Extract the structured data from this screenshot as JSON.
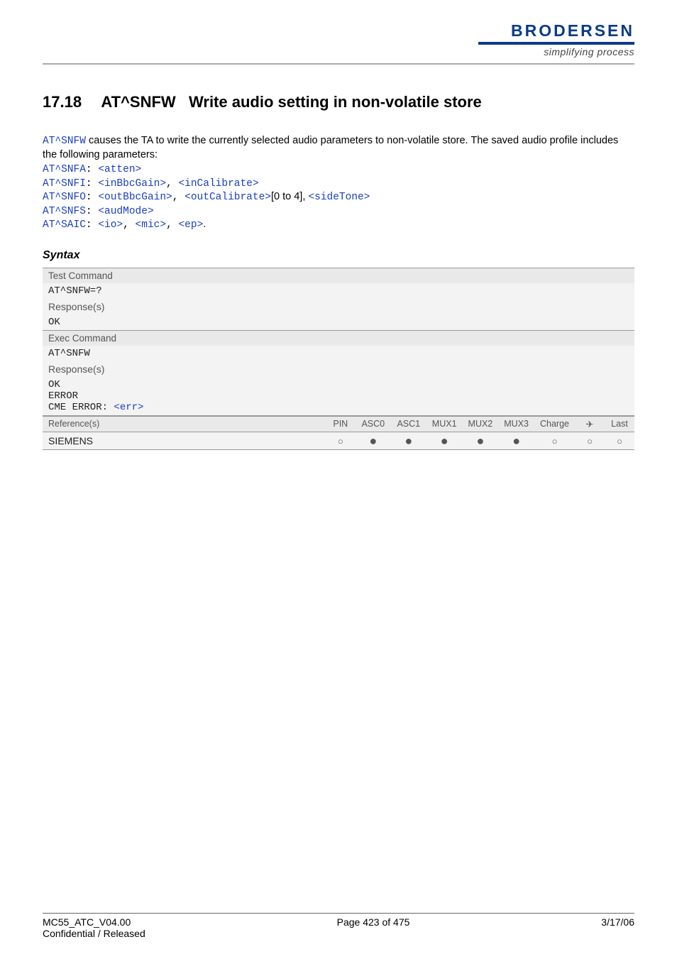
{
  "header": {
    "brand": "BRODERSEN",
    "tagline": "simplifying process"
  },
  "title": {
    "number": "17.18",
    "cmd": "AT^SNFW",
    "rest": "Write audio setting in non-volatile store"
  },
  "intro": {
    "cmd": "AT^SNFW",
    "text_after_cmd": " causes the TA to write the currently selected audio parameters to non-volatile store. The saved audio profile includes the following parameters:"
  },
  "params": {
    "l1": {
      "cmd": "AT^SNFA",
      "sep": ": ",
      "p": [
        "<atten>"
      ]
    },
    "l2": {
      "cmd": "AT^SNFI",
      "sep": ": ",
      "p": [
        "<inBbcGain>",
        "<inCalibrate>"
      ]
    },
    "l3": {
      "cmd": "AT^SNFO",
      "sep": ": ",
      "p": [
        "<outBbcGain>",
        "<outCalibrate>"
      ],
      "mid": "[0 to 4], ",
      "p2": [
        "<sideTone>"
      ]
    },
    "l4": {
      "cmd": "AT^SNFS",
      "sep": ": ",
      "p": [
        "<audMode>"
      ]
    },
    "l5": {
      "cmd": "AT^SAIC",
      "sep": ": ",
      "p": [
        "<io>",
        "<mic>",
        "<ep>"
      ],
      "tail": "."
    }
  },
  "syntax_label": "Syntax",
  "table": {
    "test_command_label": "Test Command",
    "test_command": "AT^SNFW=?",
    "responses_label": "Response(s)",
    "ok": "OK",
    "exec_command_label": "Exec Command",
    "exec_command": "AT^SNFW",
    "error": "ERROR",
    "cme_prefix": "CME ERROR: ",
    "cme_err": "<err>",
    "references_label": "Reference(s)",
    "cols": {
      "pin": "PIN",
      "asc0": "ASC0",
      "asc1": "ASC1",
      "mux1": "MUX1",
      "mux2": "MUX2",
      "mux3": "MUX3",
      "charge": "Charge",
      "air": "✈",
      "last": "Last"
    },
    "ref_value": "SIEMENS",
    "dots": {
      "pin": "○",
      "asc0": "●",
      "asc1": "●",
      "mux1": "●",
      "mux2": "●",
      "mux3": "●",
      "charge": "○",
      "air": "○",
      "last": "○"
    }
  },
  "footer": {
    "left1": "MC55_ATC_V04.00",
    "left2": "Confidential / Released",
    "center": "Page 423 of 475",
    "right": "3/17/06"
  }
}
